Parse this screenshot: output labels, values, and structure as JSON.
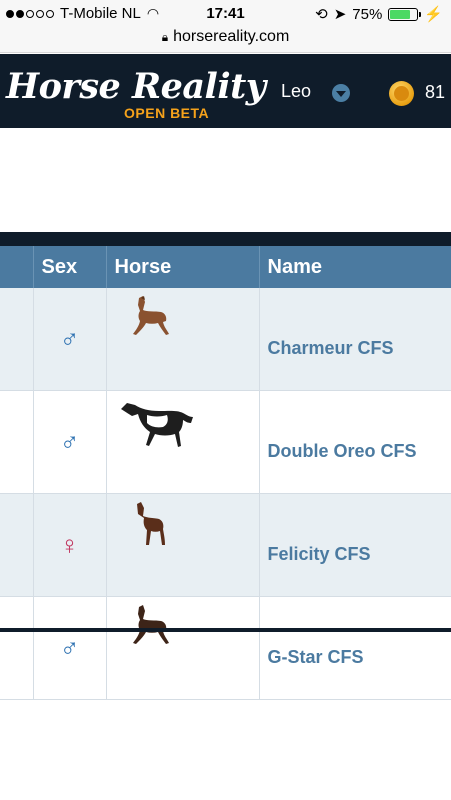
{
  "status_bar": {
    "carrier": "T-Mobile NL",
    "time": "17:41",
    "battery": "75%",
    "battery_level": 0.75
  },
  "url_bar": {
    "domain": "horsereality.com"
  },
  "header": {
    "logo_title": "Horse Reality",
    "logo_subtitle": "OPEN BETA",
    "username": "Leo",
    "coins": "81"
  },
  "table": {
    "columns": [
      "Sex",
      "Horse",
      "Name"
    ],
    "rows": [
      {
        "sex": "♂",
        "name": "Charmeur CFS"
      },
      {
        "sex": "♂",
        "name": "Double Oreo CFS"
      },
      {
        "sex": "♀",
        "name": "Felicity CFS"
      },
      {
        "sex": "♂",
        "name": "G-Star CFS"
      }
    ]
  },
  "colors": {
    "header_bg": "#0f1c2a",
    "table_header_bg": "#4b7aa0",
    "name_text": "#4b7aa0",
    "male_symbol": "#2a6fb0",
    "female_symbol": "#c0355e",
    "coin": "#e8a013",
    "logo_subtitle": "#f5a21b"
  }
}
